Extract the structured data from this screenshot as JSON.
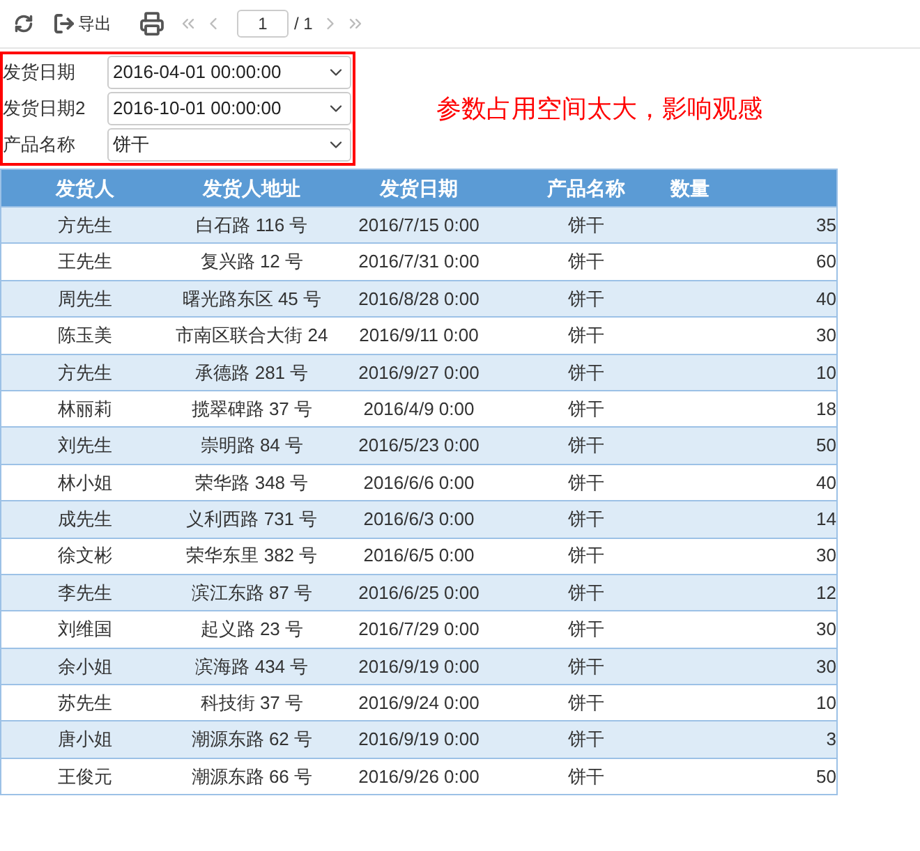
{
  "toolbar": {
    "export_label": "导出",
    "page_input": "1",
    "page_total": "/ 1"
  },
  "params": [
    {
      "label": "发货日期",
      "value": "2016-04-01 00:00:00"
    },
    {
      "label": "发货日期2",
      "value": "2016-10-01 00:00:00"
    },
    {
      "label": "产品名称",
      "value": "饼干"
    }
  ],
  "annotation": "参数占用空间太大，影响观感",
  "table": {
    "columns": [
      "发货人",
      "发货人地址",
      "发货日期",
      "产品名称",
      "数量"
    ],
    "rows": [
      [
        "方先生",
        "白石路 116 号",
        "2016/7/15 0:00",
        "饼干",
        "35"
      ],
      [
        "王先生",
        "复兴路 12 号",
        "2016/7/31 0:00",
        "饼干",
        "60"
      ],
      [
        "周先生",
        "曙光路东区 45 号",
        "2016/8/28 0:00",
        "饼干",
        "40"
      ],
      [
        "陈玉美",
        "市南区联合大街 24",
        "2016/9/11 0:00",
        "饼干",
        "30"
      ],
      [
        "方先生",
        "承德路 281 号",
        "2016/9/27 0:00",
        "饼干",
        "10"
      ],
      [
        "林丽莉",
        "揽翠碑路 37 号",
        "2016/4/9 0:00",
        "饼干",
        "18"
      ],
      [
        "刘先生",
        "崇明路 84 号",
        "2016/5/23 0:00",
        "饼干",
        "50"
      ],
      [
        "林小姐",
        "荣华路 348 号",
        "2016/6/6 0:00",
        "饼干",
        "40"
      ],
      [
        "成先生",
        "义利西路 731 号",
        "2016/6/3 0:00",
        "饼干",
        "14"
      ],
      [
        "徐文彬",
        "荣华东里 382 号",
        "2016/6/5 0:00",
        "饼干",
        "30"
      ],
      [
        "李先生",
        "滨江东路 87 号",
        "2016/6/25 0:00",
        "饼干",
        "12"
      ],
      [
        "刘维国",
        "起义路 23 号",
        "2016/7/29 0:00",
        "饼干",
        "30"
      ],
      [
        "余小姐",
        "滨海路 434 号",
        "2016/9/19 0:00",
        "饼干",
        "30"
      ],
      [
        "苏先生",
        "科技街 37 号",
        "2016/9/24 0:00",
        "饼干",
        "10"
      ],
      [
        "唐小姐",
        "潮源东路 62 号",
        "2016/9/19 0:00",
        "饼干",
        "3"
      ],
      [
        "王俊元",
        "潮源东路 66 号",
        "2016/9/26 0:00",
        "饼干",
        "50"
      ]
    ]
  }
}
